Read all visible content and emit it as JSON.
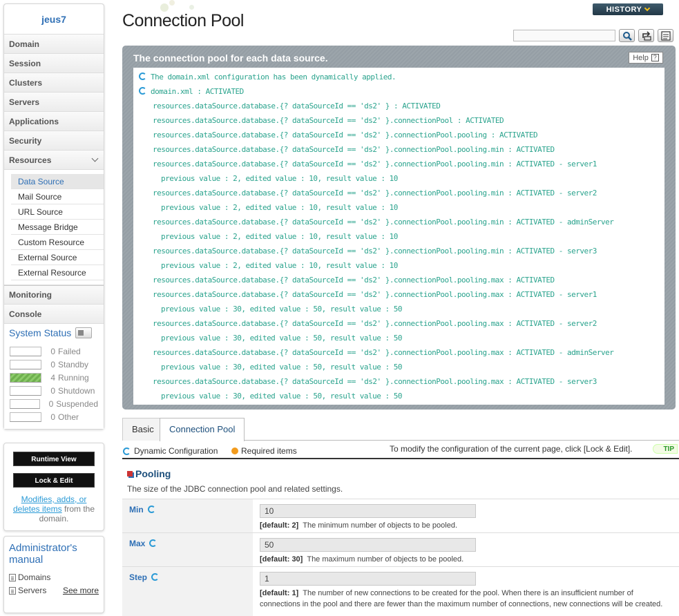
{
  "sidebar": {
    "server_name": "jeus7",
    "menus_top": [
      "Domain",
      "Session",
      "Clusters",
      "Servers",
      "Applications",
      "Security"
    ],
    "resources_label": "Resources",
    "resources_sub": [
      "Data Source",
      "Mail Source",
      "URL Source",
      "Message Bridge",
      "Custom Resource",
      "External Source",
      "External Resource"
    ],
    "menus_bottom": [
      "Monitoring",
      "Console"
    ],
    "status_title": "System Status",
    "status": [
      {
        "count": "0",
        "label": "Failed"
      },
      {
        "count": "0",
        "label": "Standby"
      },
      {
        "count": "4",
        "label": "Running"
      },
      {
        "count": "0",
        "label": "Shutdown"
      },
      {
        "count": "0",
        "label": "Suspended"
      },
      {
        "count": "0",
        "label": "Other"
      }
    ],
    "runtime_view": "Runtime View",
    "lock_edit": "Lock & Edit",
    "note_link": "Modifies, adds, or deletes items",
    "note_rest": " from the domain.",
    "manual_title": "Administrator's manual",
    "manual_items": [
      "Domains",
      "Servers"
    ],
    "see_more": "See more"
  },
  "header": {
    "title": "Connection Pool",
    "history": "HISTORY"
  },
  "result": {
    "heading": "The connection pool for each data source.",
    "help": "Help",
    "help_q": "?",
    "lines": [
      "The domain.xml configuration has been dynamically applied.",
      "domain.xml : ACTIVATED",
      "resources.dataSource.database.{? dataSourceId == 'ds2' } : ACTIVATED",
      "resources.dataSource.database.{? dataSourceId == 'ds2' }.connectionPool : ACTIVATED",
      "resources.dataSource.database.{? dataSourceId == 'ds2' }.connectionPool.pooling : ACTIVATED",
      "resources.dataSource.database.{? dataSourceId == 'ds2' }.connectionPool.pooling.min : ACTIVATED",
      "resources.dataSource.database.{? dataSourceId == 'ds2' }.connectionPool.pooling.min : ACTIVATED - server1",
      "previous value : 2, edited value : 10, result value : 10",
      "resources.dataSource.database.{? dataSourceId == 'ds2' }.connectionPool.pooling.min : ACTIVATED - server2",
      "previous value : 2, edited value : 10, result value : 10",
      "resources.dataSource.database.{? dataSourceId == 'ds2' }.connectionPool.pooling.min : ACTIVATED - adminServer",
      "previous value : 2, edited value : 10, result value : 10",
      "resources.dataSource.database.{? dataSourceId == 'ds2' }.connectionPool.pooling.min : ACTIVATED - server3",
      "previous value : 2, edited value : 10, result value : 10",
      "resources.dataSource.database.{? dataSourceId == 'ds2' }.connectionPool.pooling.max : ACTIVATED",
      "resources.dataSource.database.{? dataSourceId == 'ds2' }.connectionPool.pooling.max : ACTIVATED - server1",
      "previous value : 30, edited value : 50, result value : 50",
      "resources.dataSource.database.{? dataSourceId == 'ds2' }.connectionPool.pooling.max : ACTIVATED - server2",
      "previous value : 30, edited value : 50, result value : 50",
      "resources.dataSource.database.{? dataSourceId == 'ds2' }.connectionPool.pooling.max : ACTIVATED - adminServer",
      "previous value : 30, edited value : 50, result value : 50",
      "resources.dataSource.database.{? dataSourceId == 'ds2' }.connectionPool.pooling.max : ACTIVATED - server3",
      "previous value : 30, edited value : 50, result value : 50"
    ]
  },
  "tabs": [
    "Basic",
    "Connection Pool"
  ],
  "config": {
    "dynamic": "Dynamic Configuration",
    "required": "Required items",
    "hint": "To modify the configuration of the current page, click [Lock & Edit].",
    "tip": "TIP"
  },
  "section": {
    "title": "Pooling",
    "desc": "The size of the JDBC connection pool and related settings."
  },
  "fields": [
    {
      "label": "Min",
      "value": "10",
      "default": "[default: 2]",
      "desc": "The minimum number of objects to be pooled."
    },
    {
      "label": "Max",
      "value": "50",
      "default": "[default: 30]",
      "desc": "The maximum number of objects to be pooled."
    },
    {
      "label": "Step",
      "value": "1",
      "default": "[default: 1]",
      "desc": "The number of new connections to be created for the pool. When there is an insufficient number of connections in the pool and there are fewer than the maximum number of connections, new connections will be created."
    }
  ]
}
